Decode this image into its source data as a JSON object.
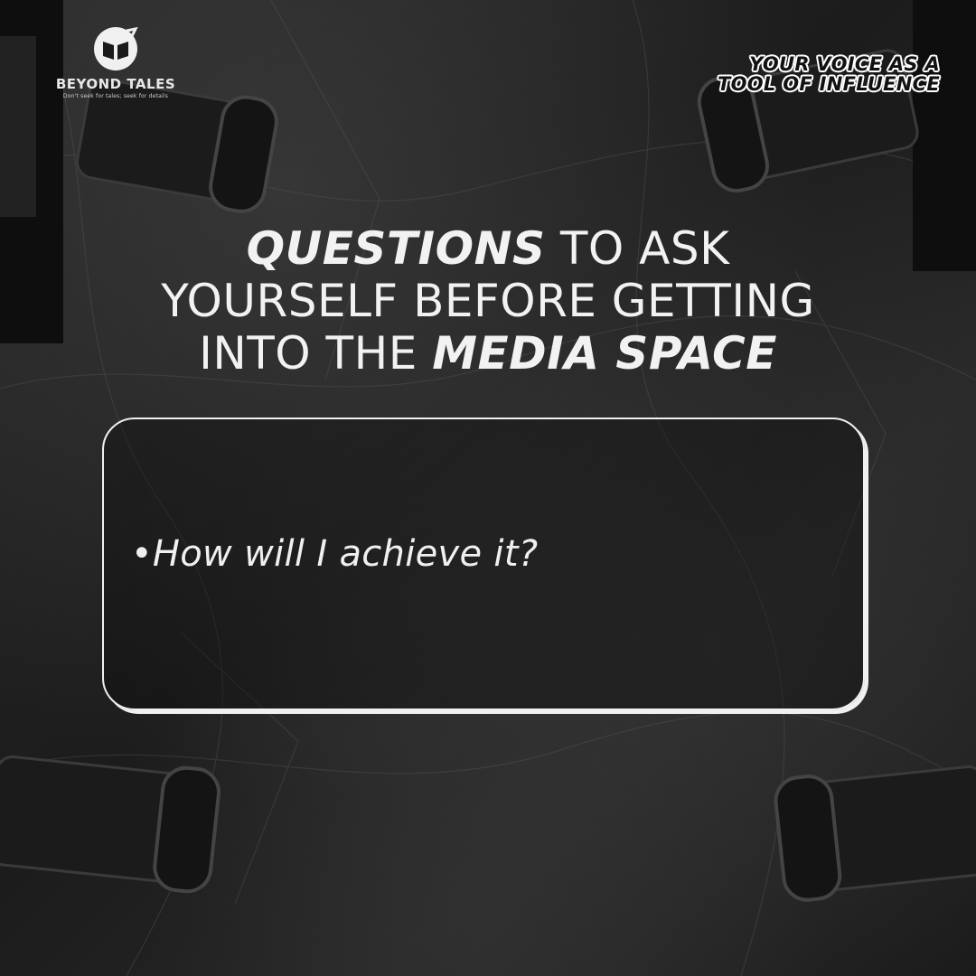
{
  "brand": {
    "name": "BEYOND TALES",
    "tagline": "Don't seek for tales; seek for details"
  },
  "tagline": {
    "line1": "YOUR VOICE AS A",
    "line2": "TOOL OF INFLUENCE"
  },
  "headline": {
    "line1_em": "QUESTIONS",
    "line1_rest": " TO ASK",
    "line2": "YOURSELF BEFORE GETTING",
    "line3_plain": "INTO THE ",
    "line3_em": "MEDIA SPACE"
  },
  "card": {
    "question": "•How will I achieve it?"
  },
  "colors": {
    "background": "#1c1c1c",
    "text": "#f2f2f2",
    "card_border": "#f0f0f0"
  },
  "icons": [
    "book-logo-icon",
    "microphone-icon"
  ]
}
